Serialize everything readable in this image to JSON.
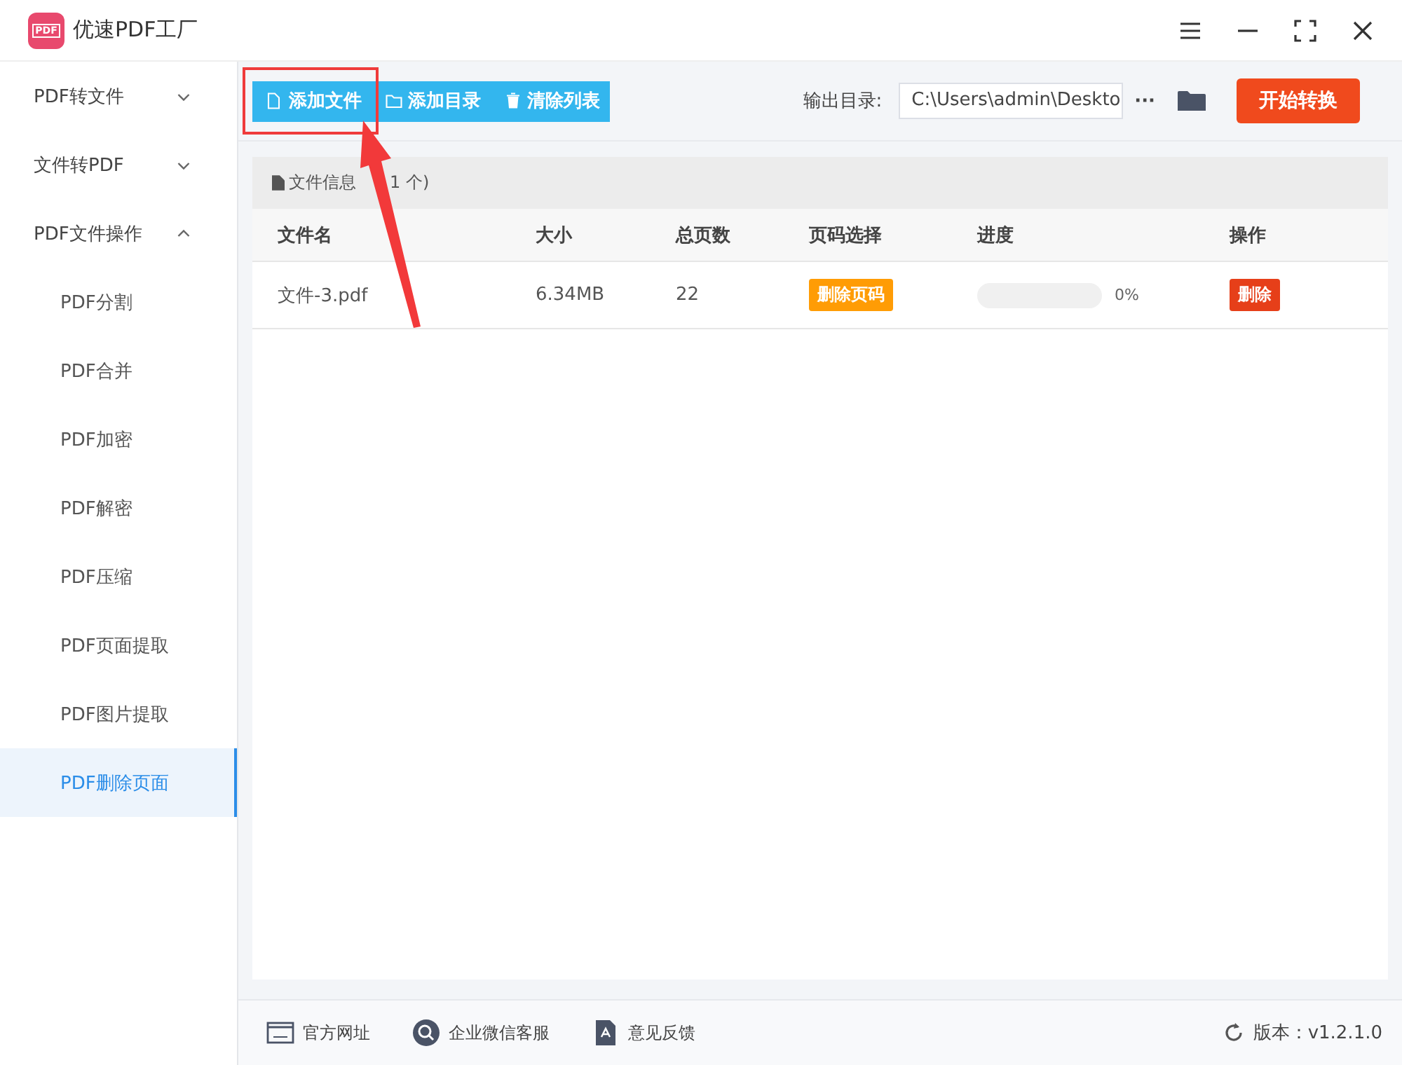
{
  "app": {
    "title": "优速PDF工厂",
    "logo_text": "PDF"
  },
  "sidebar": {
    "items": [
      {
        "label": "PDF转文件",
        "expanded": false
      },
      {
        "label": "文件转PDF",
        "expanded": false
      },
      {
        "label": "PDF文件操作",
        "expanded": true,
        "children": [
          {
            "label": "PDF分割",
            "selected": false
          },
          {
            "label": "PDF合并",
            "selected": false
          },
          {
            "label": "PDF加密",
            "selected": false
          },
          {
            "label": "PDF解密",
            "selected": false
          },
          {
            "label": "PDF压缩",
            "selected": false
          },
          {
            "label": "PDF页面提取",
            "selected": false
          },
          {
            "label": "PDF图片提取",
            "selected": false
          },
          {
            "label": "PDF删除页面",
            "selected": true
          }
        ]
      }
    ]
  },
  "toolbar": {
    "buttons": [
      {
        "kind": "file",
        "label": "添加文件"
      },
      {
        "kind": "folder",
        "label": "添加目录"
      },
      {
        "kind": "trash",
        "label": "清除列表"
      }
    ],
    "output_label": "输出目录:",
    "output_path": "C:\\Users\\admin\\Deskto",
    "more": "···",
    "start_button": "开始转换"
  },
  "file_panel": {
    "header": "文件信息",
    "count": "1 个)",
    "columns": [
      "文件名",
      "大小",
      "总页数",
      "页码选择",
      "进度",
      "操作"
    ],
    "rows": [
      {
        "name": "文件-3.pdf",
        "size": "6.34MB",
        "pages": "22",
        "page_button": "删除页码",
        "level": 0,
        "progress": "0%",
        "action": "删除"
      }
    ]
  },
  "footer": {
    "links": [
      {
        "kind": "web",
        "label": "官方网址"
      },
      {
        "kind": "chat",
        "label": "企业微信客服"
      },
      {
        "kind": "feedback",
        "label": "意见反馈"
      }
    ],
    "version": "版本：v1.2.1.0"
  }
}
